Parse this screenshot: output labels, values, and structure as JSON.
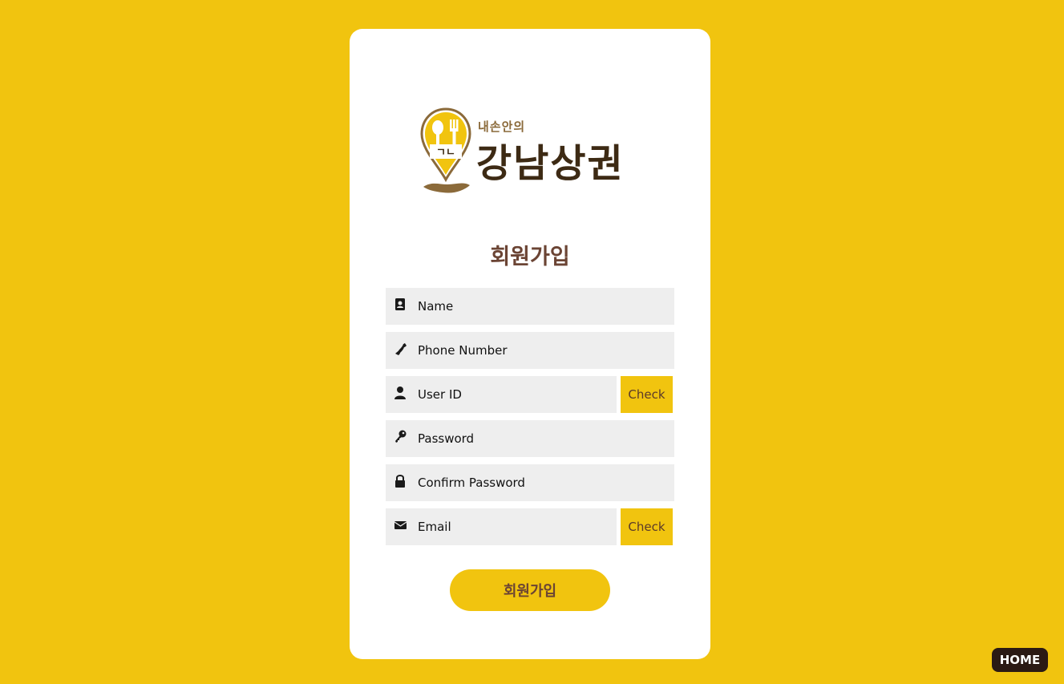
{
  "logo": {
    "tagline": "내손안의",
    "brand": "강남상권",
    "pin_label": "ㄱㄴ"
  },
  "form": {
    "title": "회원가입",
    "fields": [
      {
        "placeholder": "Name",
        "icon": "contact-card-icon"
      },
      {
        "placeholder": "Phone Number",
        "icon": "phone-icon"
      },
      {
        "placeholder": "User ID",
        "icon": "user-icon"
      },
      {
        "placeholder": "Password",
        "icon": "key-icon"
      },
      {
        "placeholder": "Confirm Password",
        "icon": "lock-icon"
      },
      {
        "placeholder": "Email",
        "icon": "envelope-icon"
      }
    ],
    "check_userid_label": "Check",
    "check_email_label": "Check",
    "submit_label": "회원가입"
  },
  "home_label": "HOME",
  "colors": {
    "background": "#f1c40f",
    "card": "#ffffff",
    "field_bg": "#eeeeee",
    "title": "#6b4434",
    "home_bg": "#2b1a14"
  }
}
